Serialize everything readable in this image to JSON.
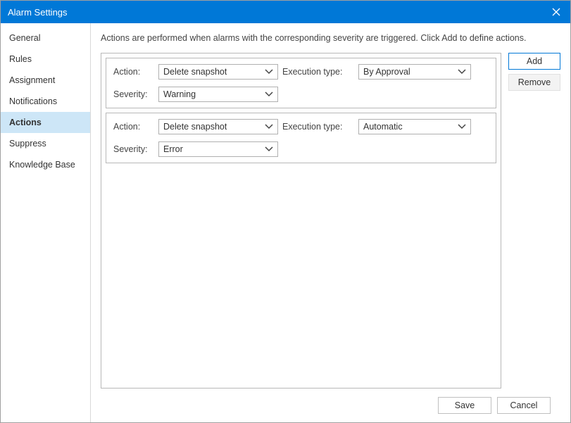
{
  "window": {
    "title": "Alarm Settings"
  },
  "sidebar": {
    "items": [
      {
        "label": "General",
        "active": false
      },
      {
        "label": "Rules",
        "active": false
      },
      {
        "label": "Assignment",
        "active": false
      },
      {
        "label": "Notifications",
        "active": false
      },
      {
        "label": "Actions",
        "active": true
      },
      {
        "label": "Suppress",
        "active": false
      },
      {
        "label": "Knowledge Base",
        "active": false
      }
    ]
  },
  "main": {
    "description": "Actions are performed when alarms with the corresponding severity are triggered. Click Add to define actions.",
    "labels": {
      "action": "Action:",
      "severity": "Severity:",
      "execution_type": "Execution type:"
    },
    "records": [
      {
        "action": "Delete snapshot",
        "severity": "Warning",
        "execution_type": "By Approval"
      },
      {
        "action": "Delete snapshot",
        "severity": "Error",
        "execution_type": "Automatic"
      }
    ],
    "buttons": {
      "add": "Add",
      "remove": "Remove"
    }
  },
  "footer": {
    "save": "Save",
    "cancel": "Cancel"
  }
}
